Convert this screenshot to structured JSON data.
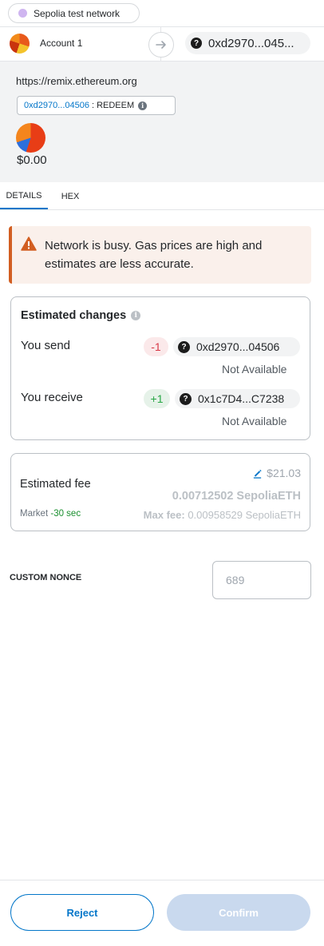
{
  "network": {
    "name": "Sepolia test network",
    "dot_color": "#cfb5f0"
  },
  "account": {
    "name": "Account 1",
    "recipient": "0xd2970...045..."
  },
  "origin": {
    "url": "https://remix.ethereum.org",
    "method_address": "0xd2970...04506",
    "method_label": ": REDEEM",
    "balance": "$0.00"
  },
  "tabs": [
    {
      "label": "DETAILS",
      "active": true
    },
    {
      "label": "HEX",
      "active": false
    }
  ],
  "warning": {
    "text": "Network is busy. Gas prices are high and estimates are less accurate."
  },
  "estimated_changes": {
    "title": "Estimated changes",
    "send": {
      "label": "You send",
      "amount": "-1",
      "address": "0xd2970...04506",
      "status": "Not Available"
    },
    "receive": {
      "label": "You receive",
      "amount": "+1",
      "address": "0x1c7D4...C7238",
      "status": "Not Available"
    }
  },
  "fee": {
    "title": "Estimated fee",
    "fiat": "$21.03",
    "eth": "0.00712502 SepoliaETH",
    "market_label": "Market",
    "market_time": "-30 sec",
    "max_label": "Max fee:",
    "max_value": "0.00958529 SepoliaETH"
  },
  "nonce": {
    "label": "CUSTOM NONCE",
    "placeholder": "689"
  },
  "footer": {
    "reject_label": "Reject",
    "confirm_label": "Confirm"
  },
  "colors": {
    "accent": "#0376c9",
    "warning": "#d25e21",
    "negative": "#d73847",
    "positive": "#28a745"
  }
}
